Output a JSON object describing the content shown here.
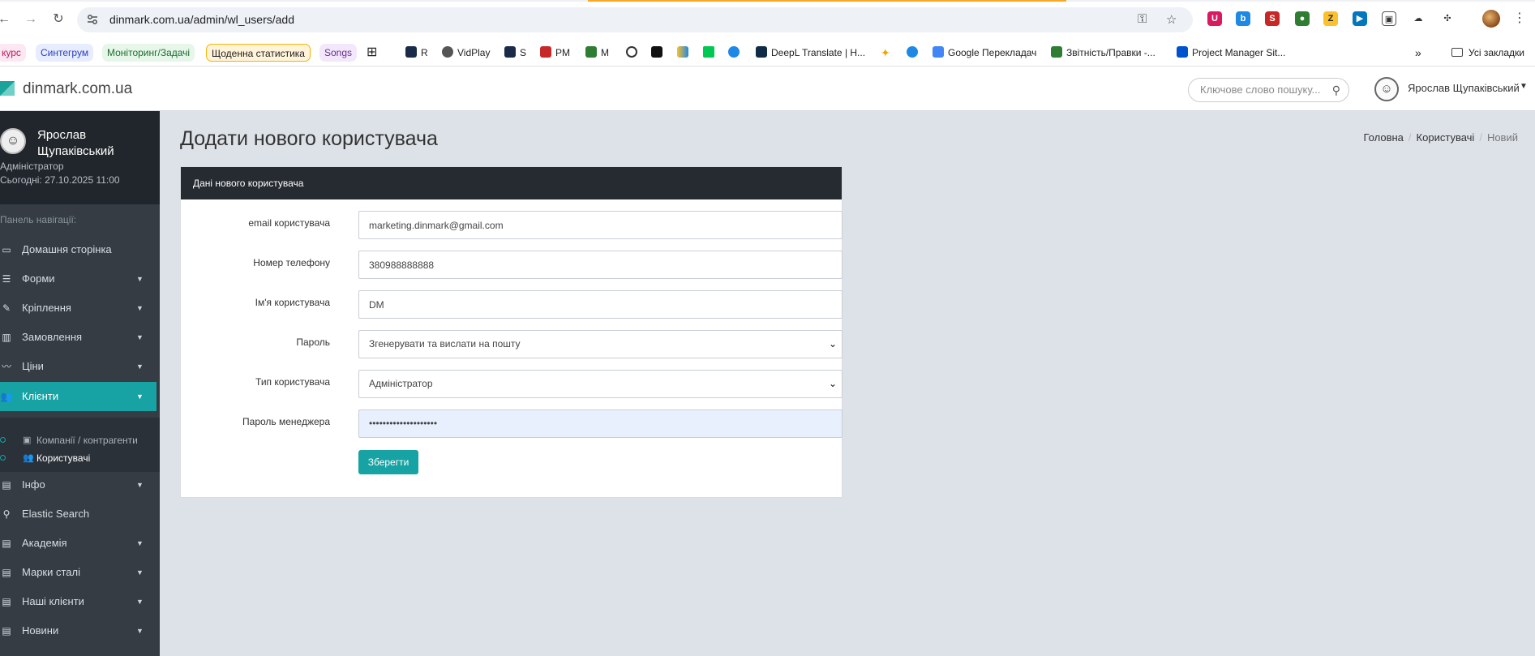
{
  "browser": {
    "url": "dinmark.com.ua/admin/wl_users/add",
    "bookmarks": [
      {
        "label": "курс",
        "bg": "#fde7f3",
        "color": "#c2185b"
      },
      {
        "label": "Синтегрум",
        "bg": "#e8ecff",
        "color": "#2b3fc0"
      },
      {
        "label": "Моніторинг/Задачі",
        "bg": "#e6f6e9",
        "color": "#1b6e2e"
      },
      {
        "label": "Щоденна статистика",
        "bg": "#fff3d9",
        "color": "#222"
      },
      {
        "label": "Songs",
        "bg": "#f3e8fb",
        "color": "#6a2d91"
      },
      {
        "label": "R"
      },
      {
        "label": "VidPlay"
      },
      {
        "label": "S"
      },
      {
        "label": "PM"
      },
      {
        "label": "M"
      },
      {
        "label": "DeepL Translate | H..."
      },
      {
        "label": "Google Перекладач"
      },
      {
        "label": "Звітність/Правки -..."
      },
      {
        "label": "Project Manager Sit..."
      },
      {
        "label": "Усі закладки"
      }
    ]
  },
  "header": {
    "brand": "dinmark.com.ua",
    "search_placeholder": "Ключове слово пошуку...",
    "user_name": "Ярослав Щупаківський"
  },
  "sidebar": {
    "user_name": "Ярослав Щупаківський",
    "role": "Адміністратор",
    "date": "Сьогодні: 27.10.2025 11:00",
    "heading": "Панель навігації:",
    "items": [
      {
        "label": "Домашня сторінка",
        "has_caret": false
      },
      {
        "label": "Форми",
        "has_caret": true
      },
      {
        "label": "Кріплення",
        "has_caret": true
      },
      {
        "label": "Замовлення",
        "has_caret": true
      },
      {
        "label": "Ціни",
        "has_caret": true
      },
      {
        "label": "Клієнти",
        "has_caret": true,
        "active": true
      },
      {
        "label": "Інфо",
        "has_caret": true
      },
      {
        "label": "Elastic Search",
        "has_caret": false
      },
      {
        "label": "Академія",
        "has_caret": true
      },
      {
        "label": "Марки сталі",
        "has_caret": true
      },
      {
        "label": "Наші клієнти",
        "has_caret": true
      },
      {
        "label": "Новини",
        "has_caret": true
      }
    ],
    "subitems": [
      {
        "label": "Компанії / контрагенти"
      },
      {
        "label": "Користувачі",
        "current": true
      }
    ],
    "accent_color": "#17a2a3"
  },
  "page": {
    "title": "Додати нового користувача",
    "breadcrumb": [
      "Головна",
      "Користувачі",
      "Новий"
    ]
  },
  "form": {
    "panel_title": "Дані нового користувача",
    "email_label": "email користувача",
    "email_value": "marketing.dinmark@gmail.com",
    "phone_label": "Номер телефону",
    "phone_value": "380988888888",
    "name_label": "Ім'я користувача",
    "name_value": "DM",
    "password_label": "Пароль",
    "password_value": "Згенерувати та вислати на пошту",
    "type_label": "Тип користувача",
    "type_value": "Адміністратор",
    "manager_password_label": "Пароль менеджера",
    "manager_password_value": "••••••••••••••••••••",
    "save_label": "Зберегти"
  }
}
